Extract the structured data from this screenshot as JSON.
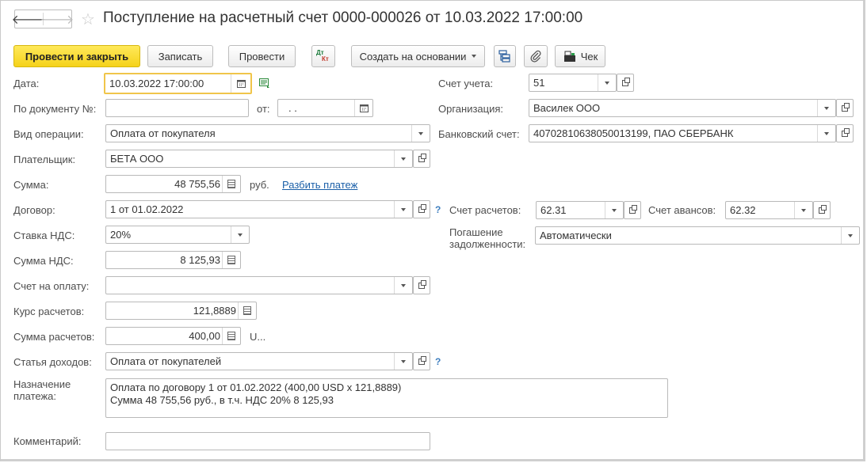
{
  "window": {
    "title": "Поступление на расчетный счет 0000-000026 от 10.03.2022 17:00:00",
    "back_glyph": "🡐",
    "forward_glyph": "🡒",
    "star_glyph": "☆"
  },
  "toolbar": {
    "post_close_label": "Провести и закрыть",
    "save_label": "Записать",
    "post_label": "Провести",
    "dtkt_top": "Дт",
    "dtkt_bottom": "Кт",
    "create_based_label": "Создать на основании",
    "receipt_label": "Чек"
  },
  "form": {
    "date": {
      "label": "Дата:",
      "value": "10.03.2022 17:00:00"
    },
    "doc_number": {
      "label": "По документу №:",
      "value": ""
    },
    "doc_from": {
      "label": "от:",
      "value": " .  ."
    },
    "operation_type": {
      "label": "Вид операции:",
      "value": "Оплата от покупателя"
    },
    "payer": {
      "label": "Плательщик:",
      "value": "БЕТА ООО"
    },
    "amount": {
      "label": "Сумма:",
      "value": "48 755,56",
      "currency": "руб.",
      "split_link": "Разбить платеж"
    },
    "contract": {
      "label": "Договор:",
      "value": "1 от 01.02.2022"
    },
    "vat_rate": {
      "label": "Ставка НДС:",
      "value": "20%"
    },
    "vat_amount": {
      "label": "Сумма НДС:",
      "value": "8 125,93"
    },
    "invoice": {
      "label": "Счет на оплату:",
      "value": ""
    },
    "rate": {
      "label": "Курс расчетов:",
      "value": "121,8889"
    },
    "settlement_amount": {
      "label": "Сумма расчетов:",
      "value": "400,00",
      "currency": "U..."
    },
    "income_item": {
      "label": "Статья доходов:",
      "value": "Оплата от покупателей"
    },
    "purpose": {
      "label_line1": "Назначение",
      "label_line2": "платежа:",
      "line1": "Оплата по договору 1 от 01.02.2022 (400,00 USD x 121,8889)",
      "line2": "Сумма 48 755,56 руб., в т.ч. НДС 20% 8 125,93"
    },
    "comment": {
      "label": "Комментарий:",
      "value": ""
    },
    "account": {
      "label": "Счет учета:",
      "value": "51"
    },
    "organization": {
      "label": "Организация:",
      "value": "Василек ООО"
    },
    "bank_account": {
      "label": "Банковский счет:",
      "value": "40702810638050013199, ПАО СБЕРБАНК"
    },
    "settlement_account": {
      "label": "Счет расчетов:",
      "value": "62.31"
    },
    "advance_account": {
      "label": "Счет авансов:",
      "value": "62.32"
    },
    "debt_repayment": {
      "label_line1": "Погашение",
      "label_line2": "задолженности:",
      "value": "Автоматически"
    },
    "help_glyph": "?"
  }
}
